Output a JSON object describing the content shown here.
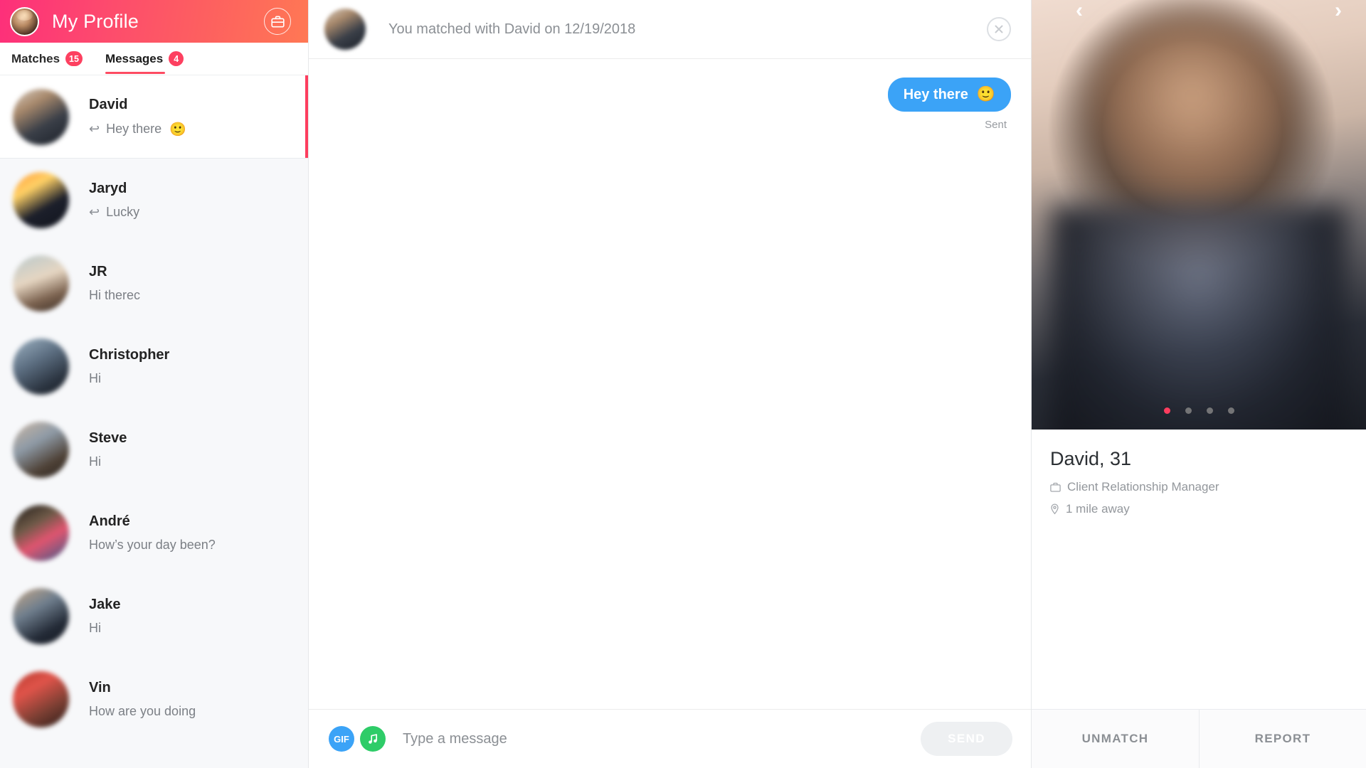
{
  "sidebar": {
    "profile_title": "My Profile",
    "briefcase_icon": "briefcase-icon",
    "avatar_icon": "my-avatar",
    "tabs": [
      {
        "label": "Matches",
        "badge": "15",
        "active": false
      },
      {
        "label": "Messages",
        "badge": "4",
        "active": true
      }
    ],
    "matches": [
      {
        "name": "David",
        "preview": "Hey there",
        "reply": true,
        "emoji": "🙂",
        "active": true
      },
      {
        "name": "Jaryd",
        "preview": "Lucky",
        "reply": true,
        "emoji": "",
        "active": false
      },
      {
        "name": "JR",
        "preview": "Hi therec",
        "reply": false,
        "emoji": "",
        "active": false
      },
      {
        "name": "Christopher",
        "preview": "Hi",
        "reply": false,
        "emoji": "",
        "active": false
      },
      {
        "name": "Steve",
        "preview": "Hi",
        "reply": false,
        "emoji": "",
        "active": false
      },
      {
        "name": "André",
        "preview": "How’s your day been?",
        "reply": false,
        "emoji": "",
        "active": false
      },
      {
        "name": "Jake",
        "preview": "Hi",
        "reply": false,
        "emoji": "",
        "active": false
      },
      {
        "name": "Vin",
        "preview": "How are you doing",
        "reply": false,
        "emoji": "",
        "active": false
      }
    ]
  },
  "chat": {
    "match_line": "You matched with David on 12/19/2018",
    "close_icon": "close-icon",
    "messages": [
      {
        "text": "Hey there",
        "emoji": "🙂",
        "status": "Sent",
        "outgoing": true
      }
    ],
    "composer": {
      "gif_label": "GIF",
      "music_icon": "music-note-icon",
      "placeholder": "Type a message",
      "value": "",
      "send_label": "SEND"
    }
  },
  "profile": {
    "name_age": "David, 31",
    "job": "Client Relationship Manager",
    "distance": "1 mile away",
    "job_icon": "briefcase-icon",
    "location_icon": "location-pin-icon",
    "carousel": {
      "count": 4,
      "active_index": 0,
      "prev": "‹",
      "next": "›"
    },
    "actions": [
      {
        "label": "UNMATCH"
      },
      {
        "label": "REPORT"
      }
    ]
  },
  "colors": {
    "brand_pink": "#fd3d5e",
    "brand_orange": "#ff7854",
    "bubble_blue": "#3ba3f7",
    "gif_blue": "#3ba3f7",
    "music_green": "#2ecc68"
  }
}
